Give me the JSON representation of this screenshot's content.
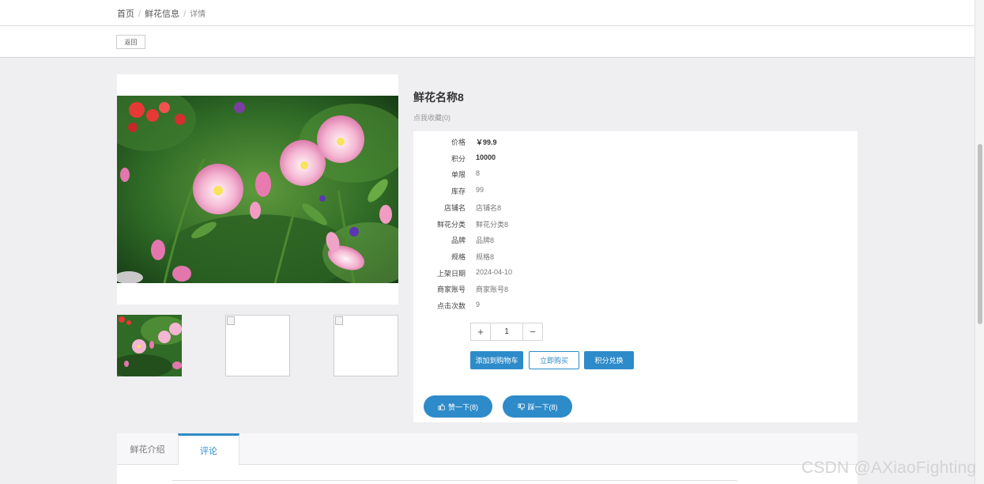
{
  "breadcrumb": {
    "home": "首页",
    "section": "鲜花信息",
    "current": "详情"
  },
  "toolbar": {
    "back_label": "返回"
  },
  "product": {
    "title": "鲜花名称8",
    "favorite_label": "点我收藏(0)",
    "fields": [
      {
        "label": "价格",
        "value": "￥99.9",
        "strong": true
      },
      {
        "label": "积分",
        "value": "10000",
        "strong": true
      },
      {
        "label": "单限",
        "value": "8"
      },
      {
        "label": "库存",
        "value": "99"
      },
      {
        "label": "店铺名",
        "value": "店铺名8"
      },
      {
        "label": "鲜花分类",
        "value": "鲜花分类8"
      },
      {
        "label": "品牌",
        "value": "品牌8"
      },
      {
        "label": "规格",
        "value": "规格8"
      },
      {
        "label": "上架日期",
        "value": "2024-04-10"
      },
      {
        "label": "商家账号",
        "value": "商家账号8"
      },
      {
        "label": "点击次数",
        "value": "9"
      }
    ],
    "quantity": {
      "plus": "+",
      "value": "1",
      "minus": "−"
    },
    "actions": {
      "add_to_cart": "添加到购物车",
      "buy_now": "立即购买",
      "points_exchange": "积分兑换"
    },
    "votes": {
      "like": "赞一下(8)",
      "dislike": "踩一下(8)"
    }
  },
  "tabs": [
    {
      "label": "鲜花介绍"
    },
    {
      "label": "评论"
    }
  ],
  "watermark": "CSDN @AXiaoFighting",
  "icons": [
    "thumbs-up-icon",
    "thumbs-down-icon",
    "broken-image-icon"
  ],
  "colors": {
    "accent": "#2e8bc9",
    "page_background": "#efeff1",
    "panel_background": "#ffffff"
  }
}
